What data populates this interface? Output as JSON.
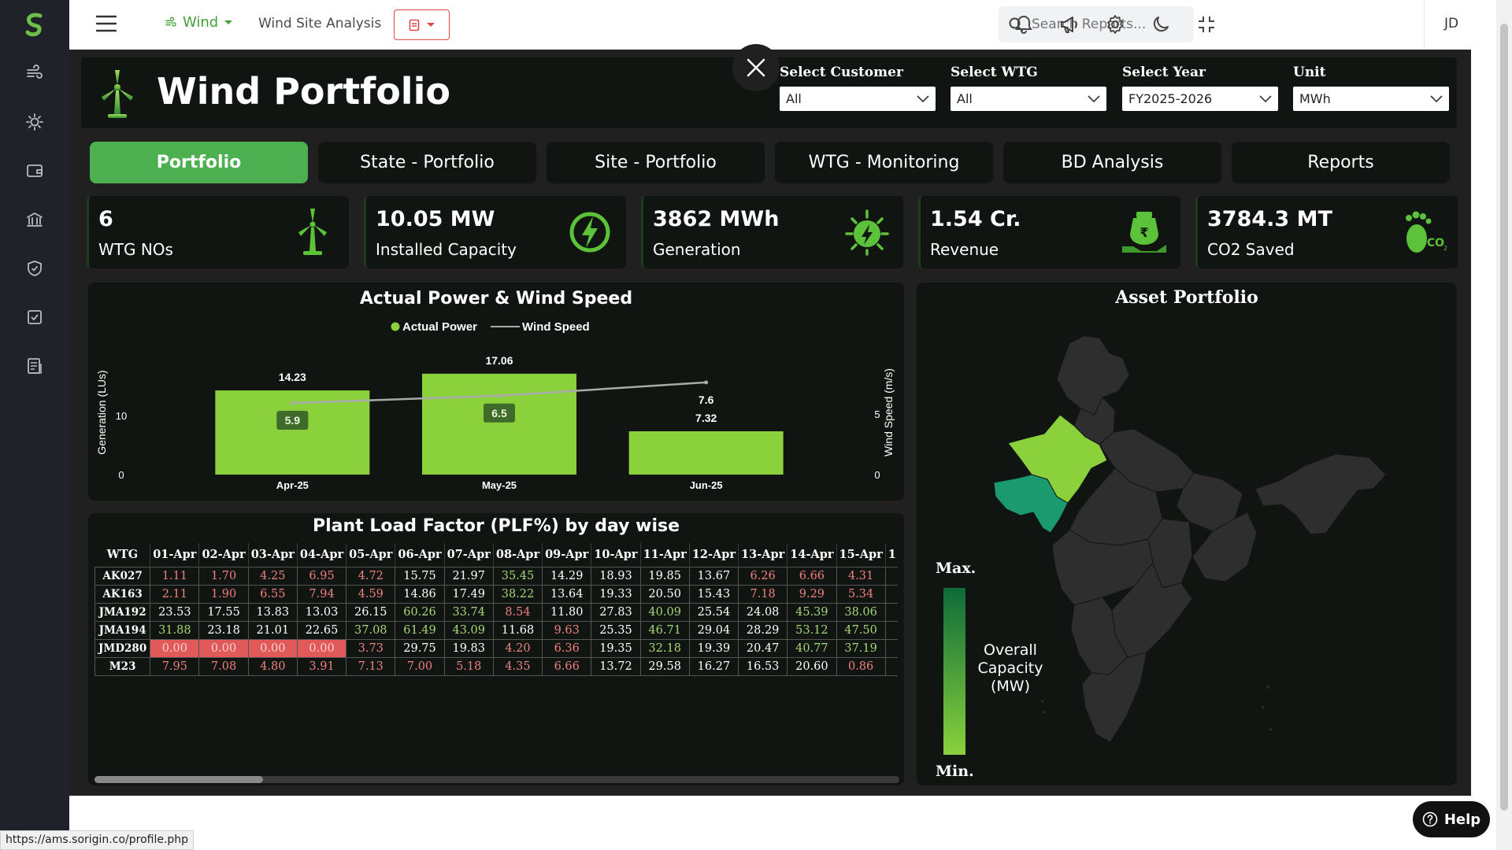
{
  "topbar": {
    "wind_menu": "Wind",
    "site_title": "Wind Site Analysis",
    "search_placeholder": "Search Reports...",
    "user_initials": "JD"
  },
  "header": {
    "title": "Wind Portfolio",
    "filters": [
      {
        "label": "Select Customer",
        "value": "All"
      },
      {
        "label": "Select WTG",
        "value": "All"
      },
      {
        "label": "Select Year",
        "value": "FY2025-2026"
      },
      {
        "label": "Unit",
        "value": "MWh"
      }
    ]
  },
  "tabs": [
    "Portfolio",
    "State - Portfolio",
    "Site - Portfolio",
    "WTG - Monitoring",
    "BD Analysis",
    "Reports"
  ],
  "kpis": [
    {
      "value": "6",
      "label": "WTG NOs",
      "icon": "turbine-icon"
    },
    {
      "value": "10.05 MW",
      "label": "Installed Capacity",
      "icon": "power-icon"
    },
    {
      "value": "3862 MWh",
      "label": "Generation",
      "icon": "generation-icon"
    },
    {
      "value": "1.54 Cr.",
      "label": "Revenue",
      "icon": "revenue-icon"
    },
    {
      "value": "3784.3 MT",
      "label": "CO2 Saved",
      "icon": "co2-footprint-icon"
    }
  ],
  "chart_data": {
    "type": "bar",
    "title": "Actual Power & Wind Speed",
    "legend": [
      "Actual Power",
      "Wind Speed"
    ],
    "legend_position": "top-center",
    "categories": [
      "Apr-25",
      "May-25",
      "Jun-25"
    ],
    "series": [
      {
        "name": "Actual Power",
        "type": "bar",
        "axis": "left",
        "values": [
          14.23,
          17.06,
          7.32
        ],
        "color": "#8ad13c"
      },
      {
        "name": "Wind Speed",
        "type": "line",
        "axis": "right",
        "values": [
          5.9,
          6.5,
          7.6
        ],
        "color": "#aaaaaa"
      }
    ],
    "ylabel_left": "Generation (LUs)",
    "ylabel_right": "Wind Speed (m/s)",
    "yticks_left": [
      "0",
      "10"
    ],
    "yticks_right": [
      "0",
      "5"
    ],
    "ylim_left": [
      0,
      19.7
    ],
    "ylim_right": [
      0,
      9.6
    ],
    "grid": false
  },
  "plf": {
    "title": "Plant Load Factor (PLF%) by day wise",
    "first_header": "WTG",
    "columns": [
      "01-Apr",
      "02-Apr",
      "03-Apr",
      "04-Apr",
      "05-Apr",
      "06-Apr",
      "07-Apr",
      "08-Apr",
      "09-Apr",
      "10-Apr",
      "11-Apr",
      "12-Apr",
      "13-Apr",
      "14-Apr",
      "15-Apr",
      "1"
    ],
    "rows": [
      {
        "wtg": "AK027",
        "values": [
          "1.11",
          "1.70",
          "4.25",
          "6.95",
          "4.72",
          "15.75",
          "21.97",
          "35.45",
          "14.29",
          "18.93",
          "19.85",
          "13.67",
          "6.26",
          "6.66",
          "4.31",
          ""
        ]
      },
      {
        "wtg": "AK163",
        "values": [
          "2.11",
          "1.90",
          "6.55",
          "7.94",
          "4.59",
          "14.86",
          "17.49",
          "38.22",
          "13.64",
          "19.33",
          "20.50",
          "15.43",
          "7.18",
          "9.29",
          "5.34",
          ""
        ]
      },
      {
        "wtg": "JMA192",
        "values": [
          "23.53",
          "17.55",
          "13.83",
          "13.03",
          "26.15",
          "60.26",
          "33.74",
          "8.54",
          "11.80",
          "27.83",
          "40.09",
          "25.54",
          "24.08",
          "45.39",
          "38.06",
          ""
        ]
      },
      {
        "wtg": "JMA194",
        "values": [
          "31.88",
          "23.18",
          "21.01",
          "22.65",
          "37.08",
          "61.49",
          "43.09",
          "11.68",
          "9.63",
          "25.35",
          "46.71",
          "29.04",
          "28.29",
          "53.12",
          "47.50",
          ""
        ]
      },
      {
        "wtg": "JMD280",
        "values": [
          "0.00",
          "0.00",
          "0.00",
          "0.00",
          "3.73",
          "29.75",
          "19.83",
          "4.20",
          "6.36",
          "19.35",
          "32.18",
          "19.39",
          "20.47",
          "40.77",
          "37.19",
          ""
        ]
      },
      {
        "wtg": "M23",
        "values": [
          "7.95",
          "7.08",
          "4.80",
          "3.91",
          "7.13",
          "7.00",
          "5.18",
          "4.35",
          "6.66",
          "13.72",
          "29.58",
          "16.27",
          "16.53",
          "20.60",
          "0.86",
          ""
        ]
      }
    ]
  },
  "map": {
    "title": "Asset Portfolio",
    "legend_max": "Max.",
    "legend_min": "Min.",
    "legend_caption": "Overall Capacity (MW)",
    "highlighted_states": [
      {
        "name": "Rajasthan",
        "color": "#8ad13c"
      },
      {
        "name": "Gujarat",
        "color": "#1a9a6e"
      }
    ]
  },
  "status_url": "https://ams.sorigin.co/profile.php",
  "help_label": "Help",
  "colors": {
    "accent": "#4caf50",
    "bar": "#8ad13c",
    "panel": "#111511"
  }
}
